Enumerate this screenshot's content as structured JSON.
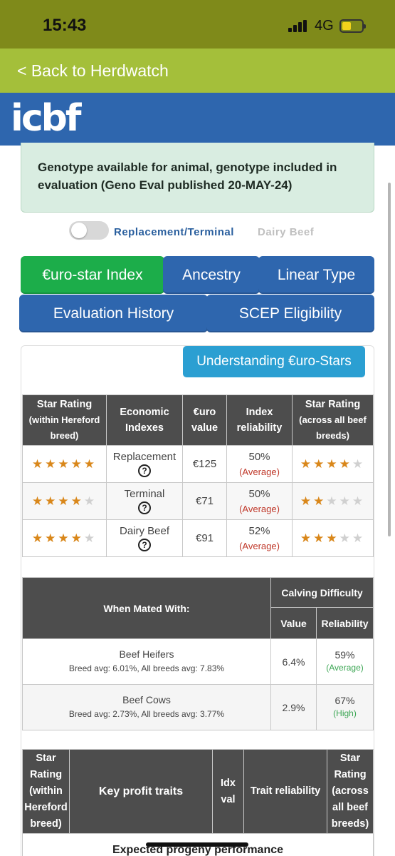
{
  "status_bar": {
    "time": "15:43",
    "network": "4G",
    "battery_level": 0.45
  },
  "nav": {
    "back_label": "< Back to Herdwatch"
  },
  "brand": {
    "logo_text": "icbf"
  },
  "notice": {
    "text": "Genotype available for animal, genotype included in evaluation (Geno Eval published 20-MAY-24)"
  },
  "toggle": {
    "left_label": "Replacement/Terminal",
    "right_label": "Dairy Beef",
    "on": false
  },
  "tabs": [
    {
      "label": "€uro-star Index",
      "active": true
    },
    {
      "label": "Ancestry",
      "active": false
    },
    {
      "label": "Linear Type",
      "active": false
    },
    {
      "label": "Evaluation History",
      "active": false
    },
    {
      "label": "SCEP Eligibility",
      "active": false
    }
  ],
  "understanding_button": "Understanding €uro-Stars",
  "star_table": {
    "headers": {
      "within_title": "Star Rating",
      "within_sub": "(within Hereford breed)",
      "economic": "Economic Indexes",
      "euro": "€uro value",
      "reliability": "Index reliability",
      "across_title": "Star Rating",
      "across_sub": "(across all beef breeds)"
    },
    "rows": [
      {
        "index": "Replacement",
        "value": "€125",
        "reliability": "50%",
        "reliability_tag": "(Average)",
        "stars_within": 5,
        "stars_across": 4
      },
      {
        "index": "Terminal",
        "value": "€71",
        "reliability": "50%",
        "reliability_tag": "(Average)",
        "stars_within": 4,
        "stars_across": 2
      },
      {
        "index": "Dairy Beef",
        "value": "€91",
        "reliability": "52%",
        "reliability_tag": "(Average)",
        "stars_within": 4,
        "stars_across": 3
      }
    ],
    "help_glyph": "?"
  },
  "calving_table": {
    "headers": {
      "mated_with": "When Mated With:",
      "calving_difficulty": "Calving Difficulty",
      "value": "Value",
      "reliability": "Reliability"
    },
    "rows": [
      {
        "label": "Beef Heifers",
        "breed_avg": "Breed avg: 6.01%, All breeds avg: 7.83%",
        "value": "6.4%",
        "reliability": "59%",
        "reliability_tag": "(Average)"
      },
      {
        "label": "Beef Cows",
        "breed_avg": "Breed avg: 2.73%, All breeds avg: 3.77%",
        "value": "2.9%",
        "reliability": "67%",
        "reliability_tag": "(High)"
      }
    ]
  },
  "traits_table": {
    "headers": {
      "within": "Star Rating (within Hereford breed)",
      "traits": "Key profit traits",
      "idx": "Idx val",
      "reliability": "Trait reliability",
      "across": "Star Rating (across all beef breeds)"
    },
    "section_label": "Expected progeny performance"
  },
  "colors": {
    "status_bar": "#7f8a1a",
    "back_bar": "#a4bf3a",
    "brand_blue": "#2e66ae",
    "active_tab": "#1cad4a",
    "info_button": "#2b9fd2",
    "star": "#d9871a",
    "table_header": "#4d4d4d"
  }
}
